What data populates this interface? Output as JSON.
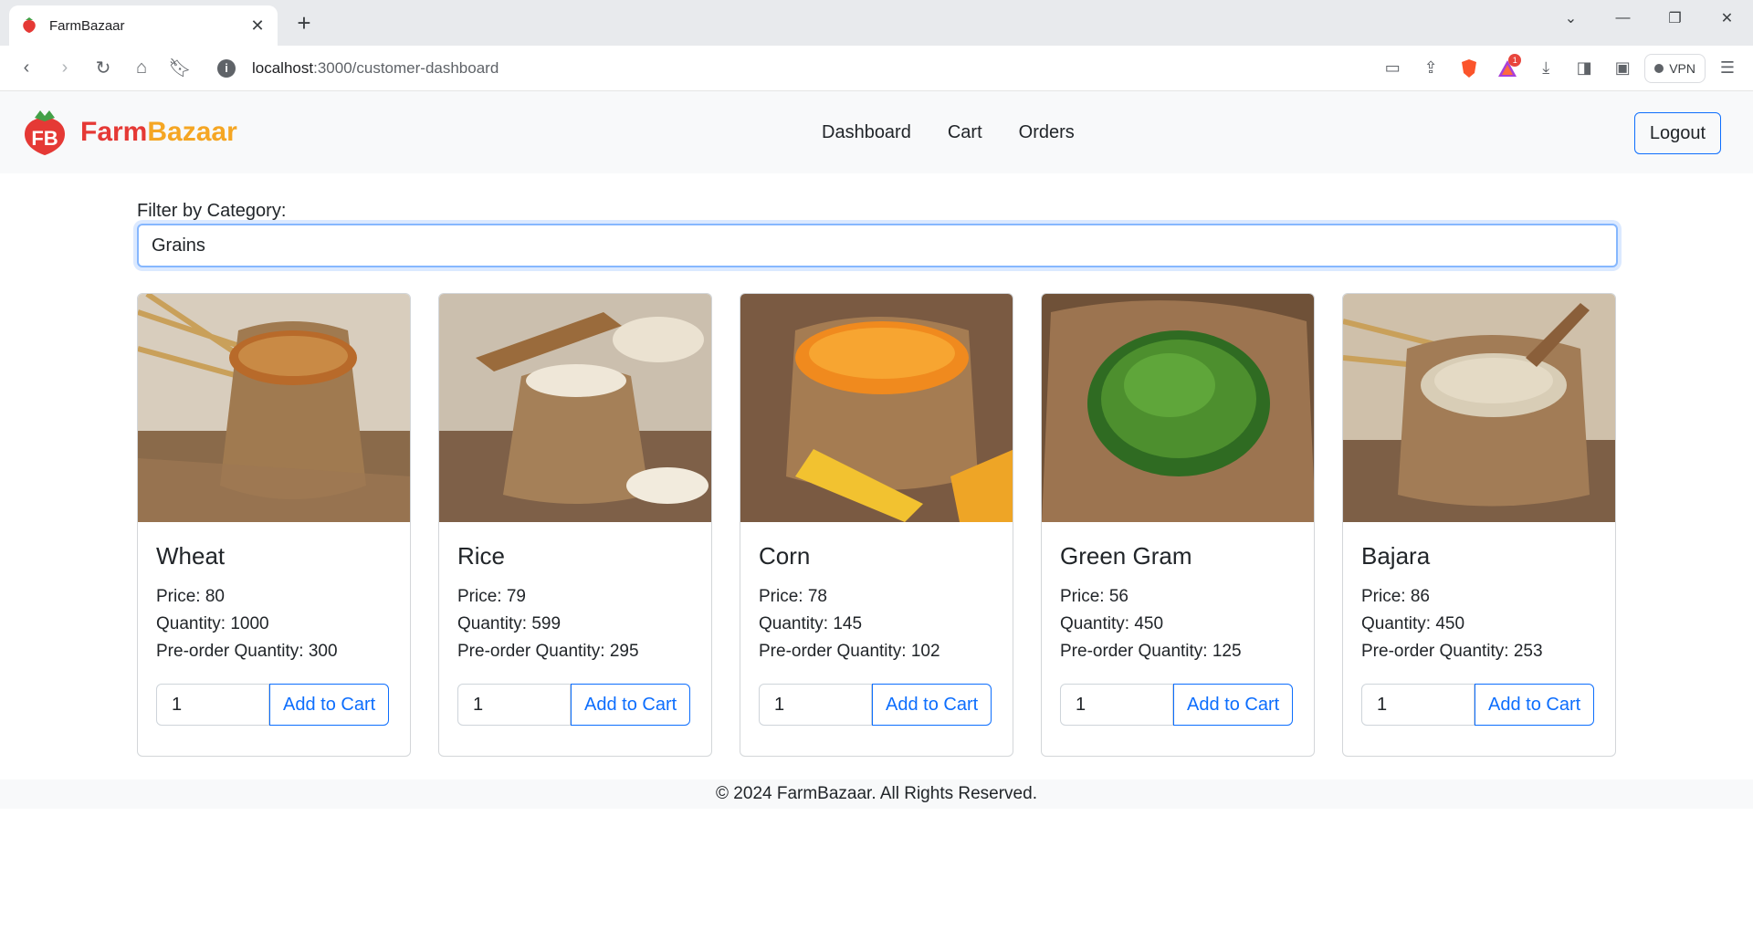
{
  "browser": {
    "tab_title": "FarmBazaar",
    "url_host": "localhost",
    "url_path": ":3000/customer-dashboard",
    "vpn_label": "VPN",
    "notification_count": "1"
  },
  "navbar": {
    "brand_part1": "Farm",
    "brand_part2": "Bazaar",
    "links": [
      "Dashboard",
      "Cart",
      "Orders"
    ],
    "logout_label": "Logout"
  },
  "filter": {
    "label": "Filter by Category:",
    "selected": "Grains"
  },
  "products": [
    {
      "name": "Wheat",
      "price": "Price: 80",
      "quantity": "Quantity: 1000",
      "preorder": "Pre-order Quantity: 300",
      "qty_value": "1",
      "button": "Add to Cart"
    },
    {
      "name": "Rice",
      "price": "Price: 79",
      "quantity": "Quantity: 599",
      "preorder": "Pre-order Quantity: 295",
      "qty_value": "1",
      "button": "Add to Cart"
    },
    {
      "name": "Corn",
      "price": "Price: 78",
      "quantity": "Quantity: 145",
      "preorder": "Pre-order Quantity: 102",
      "qty_value": "1",
      "button": "Add to Cart"
    },
    {
      "name": "Green Gram",
      "price": "Price: 56",
      "quantity": "Quantity: 450",
      "preorder": "Pre-order Quantity: 125",
      "qty_value": "1",
      "button": "Add to Cart"
    },
    {
      "name": "Bajara",
      "price": "Price: 86",
      "quantity": "Quantity: 450",
      "preorder": "Pre-order Quantity: 253",
      "qty_value": "1",
      "button": "Add to Cart"
    }
  ],
  "footer": {
    "text": "© 2024 FarmBazaar. All Rights Reserved."
  },
  "colors": {
    "brand_red": "#e53935",
    "brand_orange": "#f5a623",
    "primary": "#0d6efd"
  }
}
